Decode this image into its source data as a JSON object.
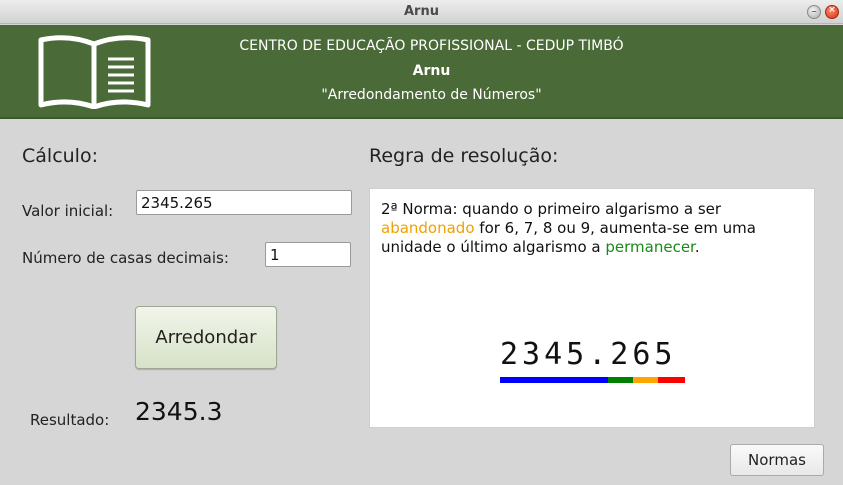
{
  "window": {
    "title": "Arnu"
  },
  "header": {
    "line1": "CENTRO DE EDUCAÇÃO PROFISSIONAL - CEDUP TIMBÓ",
    "line2": "Arnu",
    "line3": "\"Arredondamento de Números\""
  },
  "calculo": {
    "heading": "Cálculo:",
    "valor_label": "Valor inicial:",
    "valor_value": "2345.265",
    "casas_label": "Número de casas decimais:",
    "casas_value": "1",
    "button_label": "Arredondar",
    "resultado_label": "Resultado:",
    "resultado_value": "2345.3"
  },
  "regra": {
    "heading": "Regra de resolução:",
    "text_part1": "2ª Norma: quando o primeiro algarismo a ser ",
    "text_orange": "abandonado",
    "text_part2": " for 6, 7, 8 ou 9, aumenta-se em uma unidade o último algarismo a ",
    "text_green": "permanecer",
    "text_part3": ".",
    "number": "2345.265",
    "colors": {
      "kept": "#0000ff",
      "last_kept": "#008000",
      "first_abandoned": "#ffa500",
      "rest": "#ff0000"
    }
  },
  "footer": {
    "normas_label": "Normas"
  }
}
